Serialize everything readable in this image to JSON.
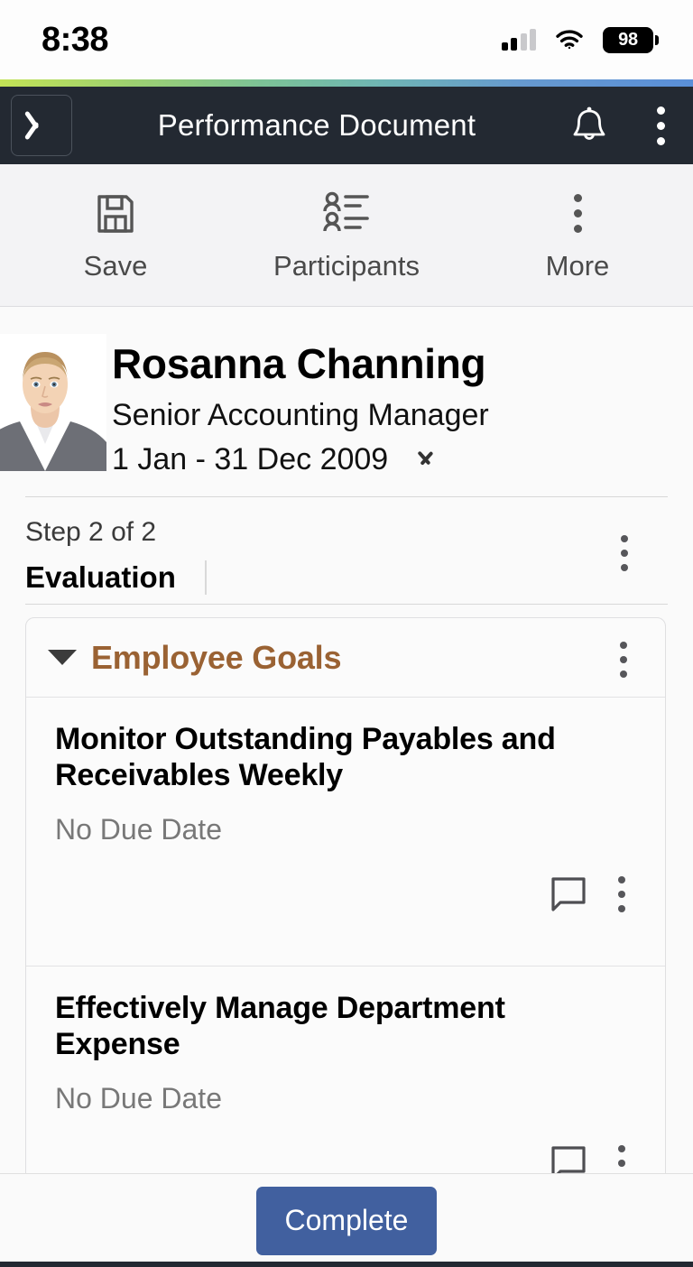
{
  "status_bar": {
    "time": "8:38",
    "battery_level": "98",
    "signal_icon": "cellular-signal-icon",
    "wifi_icon": "wifi-icon",
    "battery_icon": "battery-icon"
  },
  "header": {
    "title": "Performance Document",
    "back_icon": "chevron-left-icon",
    "bell_icon": "bell-icon",
    "overflow_icon": "kebab-menu-icon"
  },
  "toolbar": {
    "items": [
      {
        "label": "Save",
        "icon": "save-floppy-icon"
      },
      {
        "label": "Participants",
        "icon": "participants-icon"
      },
      {
        "label": "More",
        "icon": "kebab-menu-icon"
      }
    ]
  },
  "profile": {
    "name": "Rosanna Channing",
    "job_title": "Senior Accounting Manager",
    "period": "1 Jan - 31 Dec 2009",
    "period_expand_icon": "chevron-down-icon",
    "avatar": "employee-photo"
  },
  "step": {
    "step_text": "Step 2 of 2",
    "section_title": "Evaluation",
    "overflow_icon": "kebab-menu-icon"
  },
  "goals_card": {
    "title": "Employee Goals",
    "title_color": "#9a6233",
    "collapse_icon": "triangle-down-icon",
    "overflow_icon": "kebab-menu-icon",
    "goals": [
      {
        "title": "Monitor Outstanding Payables and Receivables Weekly",
        "due": "No Due Date",
        "comment_icon": "comment-bubble-icon",
        "overflow_icon": "kebab-menu-icon"
      },
      {
        "title": "Effectively Manage Department Expense",
        "due": "No Due Date",
        "comment_icon": "comment-bubble-icon",
        "overflow_icon": "kebab-menu-icon"
      }
    ]
  },
  "footer": {
    "complete_label": "Complete",
    "complete_color": "#41609f"
  }
}
